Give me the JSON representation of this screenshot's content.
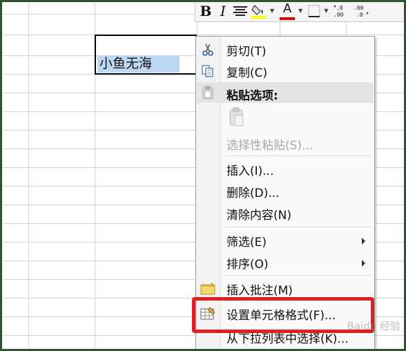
{
  "sheet": {
    "selected_cell_text": "小鱼无海"
  },
  "mini_toolbar": {
    "bold_label": "B",
    "italic_label": "I",
    "align_icon": "center-align-icon",
    "fill_icon": "fill-color-icon",
    "font_color_label": "A",
    "border_icon": "border-icon",
    "increase_decimal_icon": "increase-decimal-icon",
    "decrease_decimal_icon": "decrease-decimal-icon",
    "fill_color": "#ffff00",
    "font_color": "#e00000"
  },
  "context_menu": {
    "items": [
      {
        "label": "剪切(T)",
        "icon": "scissors-icon"
      },
      {
        "label": "复制(C)",
        "icon": "copy-icon"
      },
      {
        "label": "粘贴选项:",
        "icon": "paste-icon"
      },
      {
        "label": "",
        "icon": "paste-clipboard-icon"
      },
      {
        "label": "选择性粘贴(S)...",
        "icon": ""
      },
      {
        "label": "插入(I)...",
        "icon": ""
      },
      {
        "label": "删除(D)...",
        "icon": ""
      },
      {
        "label": "清除内容(N)",
        "icon": ""
      },
      {
        "label": "筛选(E)",
        "icon": ""
      },
      {
        "label": "排序(O)",
        "icon": ""
      },
      {
        "label": "插入批注(M)",
        "icon": "comment-icon"
      },
      {
        "label": "设置单元格格式(F)...",
        "icon": "format-cells-icon"
      },
      {
        "label": "从下拉列表中选择(K)...",
        "icon": ""
      }
    ]
  },
  "highlight_color": "#e51c23",
  "watermark": "Baidu 经验"
}
